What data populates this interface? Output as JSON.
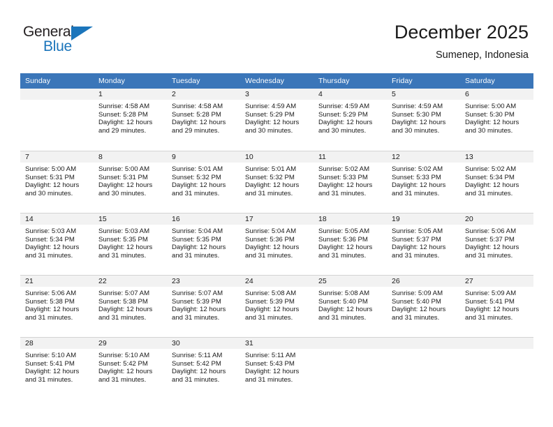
{
  "brand": {
    "name_part1": "General",
    "name_part2": "Blue",
    "triangle_icon": "blue-triangle-icon",
    "accent_color": "#1b75bb"
  },
  "header": {
    "title": "December 2025",
    "subtitle": "Sumenep, Indonesia",
    "header_bg_color": "#3b76b9",
    "daynum_bg_color": "#f2f2f2"
  },
  "weekdays": [
    "Sunday",
    "Monday",
    "Tuesday",
    "Wednesday",
    "Thursday",
    "Friday",
    "Saturday"
  ],
  "labels": {
    "sunrise": "Sunrise:",
    "sunset": "Sunset:",
    "daylight": "Daylight:"
  },
  "weeks": [
    [
      {
        "day": "",
        "sunrise": "",
        "sunset": "",
        "daylight_line1": "",
        "daylight_line2": "",
        "empty": true
      },
      {
        "day": "1",
        "sunrise": "Sunrise: 4:58 AM",
        "sunset": "Sunset: 5:28 PM",
        "daylight_line1": "Daylight: 12 hours",
        "daylight_line2": "and 29 minutes."
      },
      {
        "day": "2",
        "sunrise": "Sunrise: 4:58 AM",
        "sunset": "Sunset: 5:28 PM",
        "daylight_line1": "Daylight: 12 hours",
        "daylight_line2": "and 29 minutes."
      },
      {
        "day": "3",
        "sunrise": "Sunrise: 4:59 AM",
        "sunset": "Sunset: 5:29 PM",
        "daylight_line1": "Daylight: 12 hours",
        "daylight_line2": "and 30 minutes."
      },
      {
        "day": "4",
        "sunrise": "Sunrise: 4:59 AM",
        "sunset": "Sunset: 5:29 PM",
        "daylight_line1": "Daylight: 12 hours",
        "daylight_line2": "and 30 minutes."
      },
      {
        "day": "5",
        "sunrise": "Sunrise: 4:59 AM",
        "sunset": "Sunset: 5:30 PM",
        "daylight_line1": "Daylight: 12 hours",
        "daylight_line2": "and 30 minutes."
      },
      {
        "day": "6",
        "sunrise": "Sunrise: 5:00 AM",
        "sunset": "Sunset: 5:30 PM",
        "daylight_line1": "Daylight: 12 hours",
        "daylight_line2": "and 30 minutes."
      }
    ],
    [
      {
        "day": "7",
        "sunrise": "Sunrise: 5:00 AM",
        "sunset": "Sunset: 5:31 PM",
        "daylight_line1": "Daylight: 12 hours",
        "daylight_line2": "and 30 minutes."
      },
      {
        "day": "8",
        "sunrise": "Sunrise: 5:00 AM",
        "sunset": "Sunset: 5:31 PM",
        "daylight_line1": "Daylight: 12 hours",
        "daylight_line2": "and 30 minutes."
      },
      {
        "day": "9",
        "sunrise": "Sunrise: 5:01 AM",
        "sunset": "Sunset: 5:32 PM",
        "daylight_line1": "Daylight: 12 hours",
        "daylight_line2": "and 31 minutes."
      },
      {
        "day": "10",
        "sunrise": "Sunrise: 5:01 AM",
        "sunset": "Sunset: 5:32 PM",
        "daylight_line1": "Daylight: 12 hours",
        "daylight_line2": "and 31 minutes."
      },
      {
        "day": "11",
        "sunrise": "Sunrise: 5:02 AM",
        "sunset": "Sunset: 5:33 PM",
        "daylight_line1": "Daylight: 12 hours",
        "daylight_line2": "and 31 minutes."
      },
      {
        "day": "12",
        "sunrise": "Sunrise: 5:02 AM",
        "sunset": "Sunset: 5:33 PM",
        "daylight_line1": "Daylight: 12 hours",
        "daylight_line2": "and 31 minutes."
      },
      {
        "day": "13",
        "sunrise": "Sunrise: 5:02 AM",
        "sunset": "Sunset: 5:34 PM",
        "daylight_line1": "Daylight: 12 hours",
        "daylight_line2": "and 31 minutes."
      }
    ],
    [
      {
        "day": "14",
        "sunrise": "Sunrise: 5:03 AM",
        "sunset": "Sunset: 5:34 PM",
        "daylight_line1": "Daylight: 12 hours",
        "daylight_line2": "and 31 minutes."
      },
      {
        "day": "15",
        "sunrise": "Sunrise: 5:03 AM",
        "sunset": "Sunset: 5:35 PM",
        "daylight_line1": "Daylight: 12 hours",
        "daylight_line2": "and 31 minutes."
      },
      {
        "day": "16",
        "sunrise": "Sunrise: 5:04 AM",
        "sunset": "Sunset: 5:35 PM",
        "daylight_line1": "Daylight: 12 hours",
        "daylight_line2": "and 31 minutes."
      },
      {
        "day": "17",
        "sunrise": "Sunrise: 5:04 AM",
        "sunset": "Sunset: 5:36 PM",
        "daylight_line1": "Daylight: 12 hours",
        "daylight_line2": "and 31 minutes."
      },
      {
        "day": "18",
        "sunrise": "Sunrise: 5:05 AM",
        "sunset": "Sunset: 5:36 PM",
        "daylight_line1": "Daylight: 12 hours",
        "daylight_line2": "and 31 minutes."
      },
      {
        "day": "19",
        "sunrise": "Sunrise: 5:05 AM",
        "sunset": "Sunset: 5:37 PM",
        "daylight_line1": "Daylight: 12 hours",
        "daylight_line2": "and 31 minutes."
      },
      {
        "day": "20",
        "sunrise": "Sunrise: 5:06 AM",
        "sunset": "Sunset: 5:37 PM",
        "daylight_line1": "Daylight: 12 hours",
        "daylight_line2": "and 31 minutes."
      }
    ],
    [
      {
        "day": "21",
        "sunrise": "Sunrise: 5:06 AM",
        "sunset": "Sunset: 5:38 PM",
        "daylight_line1": "Daylight: 12 hours",
        "daylight_line2": "and 31 minutes."
      },
      {
        "day": "22",
        "sunrise": "Sunrise: 5:07 AM",
        "sunset": "Sunset: 5:38 PM",
        "daylight_line1": "Daylight: 12 hours",
        "daylight_line2": "and 31 minutes."
      },
      {
        "day": "23",
        "sunrise": "Sunrise: 5:07 AM",
        "sunset": "Sunset: 5:39 PM",
        "daylight_line1": "Daylight: 12 hours",
        "daylight_line2": "and 31 minutes."
      },
      {
        "day": "24",
        "sunrise": "Sunrise: 5:08 AM",
        "sunset": "Sunset: 5:39 PM",
        "daylight_line1": "Daylight: 12 hours",
        "daylight_line2": "and 31 minutes."
      },
      {
        "day": "25",
        "sunrise": "Sunrise: 5:08 AM",
        "sunset": "Sunset: 5:40 PM",
        "daylight_line1": "Daylight: 12 hours",
        "daylight_line2": "and 31 minutes."
      },
      {
        "day": "26",
        "sunrise": "Sunrise: 5:09 AM",
        "sunset": "Sunset: 5:40 PM",
        "daylight_line1": "Daylight: 12 hours",
        "daylight_line2": "and 31 minutes."
      },
      {
        "day": "27",
        "sunrise": "Sunrise: 5:09 AM",
        "sunset": "Sunset: 5:41 PM",
        "daylight_line1": "Daylight: 12 hours",
        "daylight_line2": "and 31 minutes."
      }
    ],
    [
      {
        "day": "28",
        "sunrise": "Sunrise: 5:10 AM",
        "sunset": "Sunset: 5:41 PM",
        "daylight_line1": "Daylight: 12 hours",
        "daylight_line2": "and 31 minutes."
      },
      {
        "day": "29",
        "sunrise": "Sunrise: 5:10 AM",
        "sunset": "Sunset: 5:42 PM",
        "daylight_line1": "Daylight: 12 hours",
        "daylight_line2": "and 31 minutes."
      },
      {
        "day": "30",
        "sunrise": "Sunrise: 5:11 AM",
        "sunset": "Sunset: 5:42 PM",
        "daylight_line1": "Daylight: 12 hours",
        "daylight_line2": "and 31 minutes."
      },
      {
        "day": "31",
        "sunrise": "Sunrise: 5:11 AM",
        "sunset": "Sunset: 5:43 PM",
        "daylight_line1": "Daylight: 12 hours",
        "daylight_line2": "and 31 minutes."
      },
      {
        "day": "",
        "sunrise": "",
        "sunset": "",
        "daylight_line1": "",
        "daylight_line2": "",
        "empty": true
      },
      {
        "day": "",
        "sunrise": "",
        "sunset": "",
        "daylight_line1": "",
        "daylight_line2": "",
        "empty": true
      },
      {
        "day": "",
        "sunrise": "",
        "sunset": "",
        "daylight_line1": "",
        "daylight_line2": "",
        "empty": true
      }
    ]
  ]
}
